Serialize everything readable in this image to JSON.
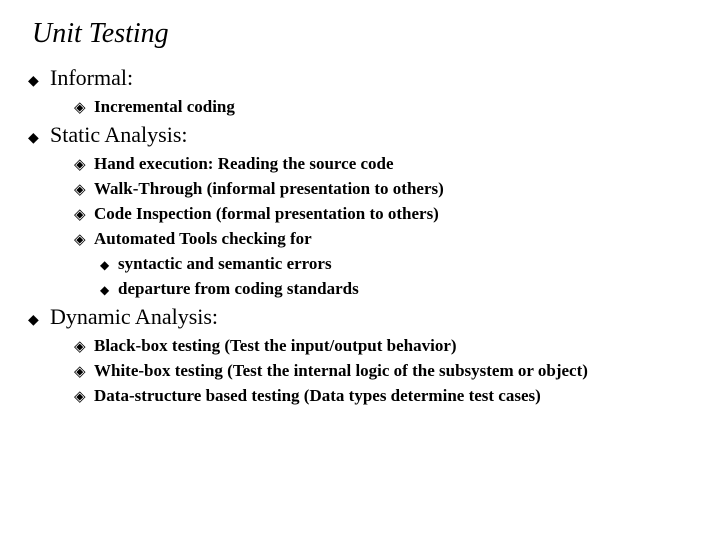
{
  "title": "Unit Testing",
  "sections": [
    {
      "heading": "Informal:",
      "items": [
        {
          "text": "Incremental coding"
        }
      ]
    },
    {
      "heading": "Static Analysis:",
      "items": [
        {
          "text": "Hand execution: Reading the  source code"
        },
        {
          "text": "Walk-Through (informal presentation to others)"
        },
        {
          "text": "Code Inspection (formal presentation to others)"
        },
        {
          "text": "Automated Tools checking for",
          "subitems": [
            "syntactic and semantic errors",
            "departure from coding standards"
          ]
        }
      ]
    },
    {
      "heading": "Dynamic Analysis:",
      "items": [
        {
          "text": "Black-box testing (Test the  input/output behavior)"
        },
        {
          "text": "White-box testing (Test the internal logic of the subsystem or object)"
        },
        {
          "text": "Data-structure based testing  (Data types determine test cases)"
        }
      ]
    }
  ]
}
